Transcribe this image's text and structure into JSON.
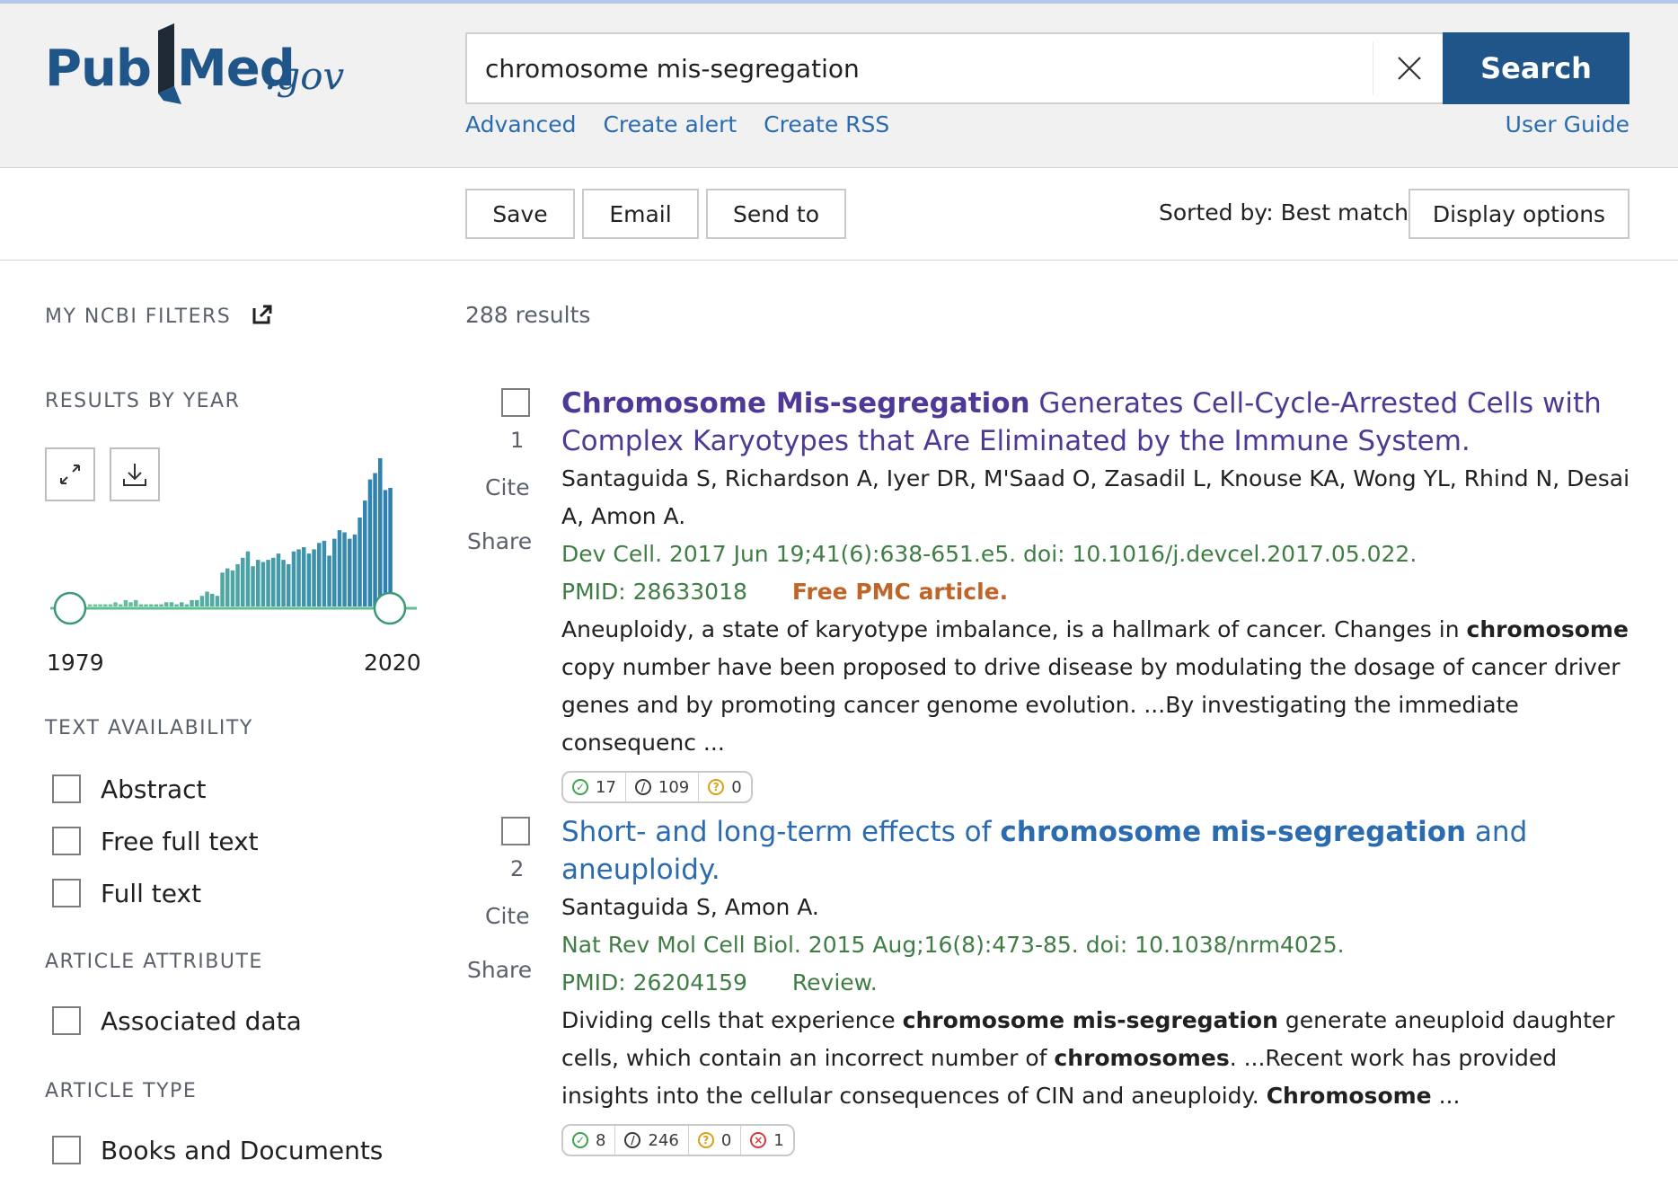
{
  "header": {
    "logo": {
      "part1": "Pub",
      "part2": "Med",
      "suffix": ".gov"
    },
    "search": {
      "value": "chromosome mis-segregation",
      "placeholder": "",
      "button_label": "Search"
    },
    "links": {
      "advanced": "Advanced",
      "create_alert": "Create alert",
      "create_rss": "Create RSS",
      "user_guide": "User Guide"
    }
  },
  "toolbar": {
    "save": "Save",
    "email": "Email",
    "send_to": "Send to",
    "sorted_by": "Sorted by: Best match",
    "display_options": "Display options"
  },
  "sidebar": {
    "my_ncbi_filters": "MY NCBI FILTERS",
    "results_by_year": "RESULTS BY YEAR",
    "year_start": "1979",
    "year_end": "2020",
    "histogram_counts": [
      1,
      1,
      1,
      1,
      1,
      2,
      1,
      3,
      2,
      3,
      1,
      1,
      1,
      1,
      1,
      2,
      2,
      1,
      2,
      1,
      3,
      3,
      5,
      7,
      6,
      5,
      16,
      18,
      17,
      20,
      23,
      26,
      19,
      22,
      21,
      22,
      23,
      25,
      22,
      20,
      26,
      27,
      28,
      25,
      27,
      30,
      31,
      24,
      32,
      36,
      35,
      32,
      34,
      42,
      50,
      60,
      63,
      70,
      55,
      56
    ],
    "text_availability": "TEXT AVAILABILITY",
    "filters_text": [
      "Abstract",
      "Free full text",
      "Full text"
    ],
    "article_attribute": "ARTICLE ATTRIBUTE",
    "filters_attr": [
      "Associated data"
    ],
    "article_type": "ARTICLE TYPE",
    "filters_type": [
      "Books and Documents"
    ]
  },
  "results": {
    "count": "288 results",
    "items": [
      {
        "number": "1",
        "cite": "Cite",
        "share": "Share",
        "title_bold": "Chromosome Mis-segregation",
        "title_rest": " Generates Cell-Cycle-Arrested Cells with Complex Karyotypes that Are Eliminated by the Immune System.",
        "authors": "Santaguida S, Richardson A, Iyer DR, M'Saad O, Zasadil L, Knouse KA, Wong YL, Rhind N, Desai A, Amon A.",
        "citation": "Dev Cell. 2017 Jun 19;41(6):638-651.e5. doi: 10.1016/j.devcel.2017.05.022.",
        "pmid": "PMID: 28633018",
        "tag": "Free PMC article.",
        "snippet_1": "Aneuploidy, a state of karyotype imbalance, is a hallmark of cancer. Changes in ",
        "snippet_b1": "chromosome",
        "snippet_2": " copy number have been proposed to drive disease by modulating the dosage of cancer driver genes and by promoting cancer genome evolution. ...By investigating the immediate consequenc ...",
        "badges": {
          "supporting": "17",
          "mentioning": "109",
          "unclassified": "0"
        }
      },
      {
        "number": "2",
        "cite": "Cite",
        "share": "Share",
        "title_pre": "Short- and long-term effects of ",
        "title_bold": "chromosome mis-segregation",
        "title_post": " and aneuploidy.",
        "authors": "Santaguida S, Amon A.",
        "citation": "Nat Rev Mol Cell Biol. 2015 Aug;16(8):473-85. doi: 10.1038/nrm4025.",
        "pmid": "PMID: 26204159",
        "tag": "Review.",
        "snippet_1": "Dividing cells that experience ",
        "snippet_b1": "chromosome mis-segregation",
        "snippet_2": " generate aneuploid daughter cells, which contain an incorrect number of ",
        "snippet_b2": "chromosomes",
        "snippet_3": ". ...Recent work has provided insights into the cellular consequences of CIN and aneuploidy. ",
        "snippet_b3": "Chromosome",
        "snippet_4": " ...",
        "badges": {
          "supporting": "8",
          "mentioning": "246",
          "unclassified": "0",
          "contrasting": "1"
        }
      }
    ]
  }
}
